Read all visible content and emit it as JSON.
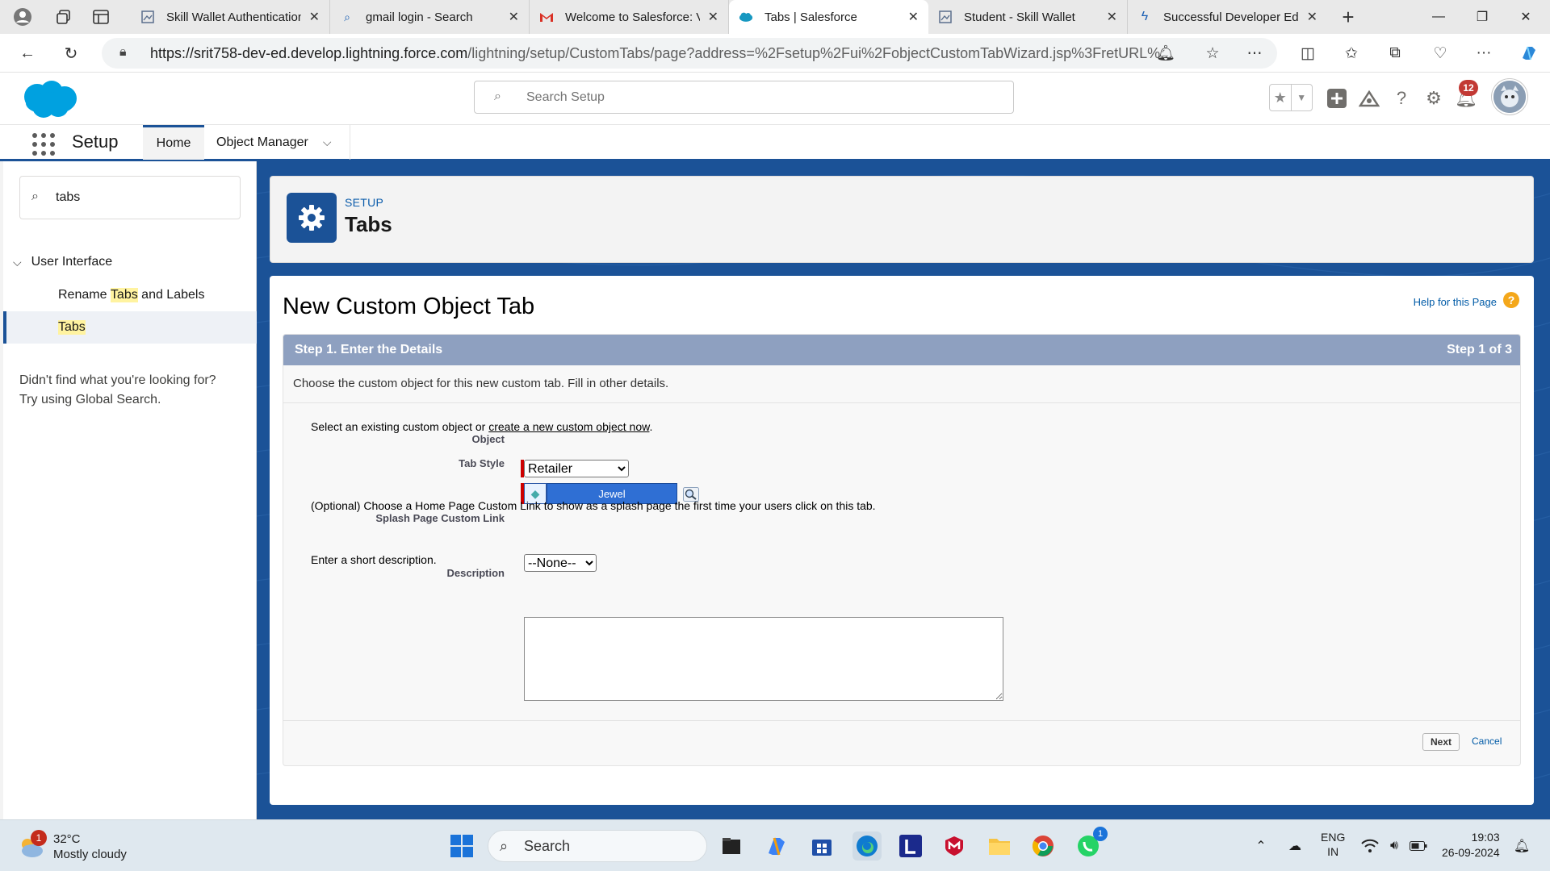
{
  "browser": {
    "tabs": [
      {
        "title": "Skill Wallet Authentication",
        "icon": "page-icon",
        "active": false
      },
      {
        "title": "gmail login - Search",
        "icon": "search-icon",
        "active": false
      },
      {
        "title": "Welcome to Salesforce: Ve",
        "icon": "gmail-icon",
        "active": false
      },
      {
        "title": "Tabs | Salesforce",
        "icon": "salesforce-cloud-icon",
        "active": true
      },
      {
        "title": "Student - Skill Wallet",
        "icon": "page-icon",
        "active": false
      },
      {
        "title": "Successful Developer Editi",
        "icon": "bolt-icon",
        "active": false
      }
    ],
    "url_host": "https://srit758-dev-ed.develop.lightning.force.com",
    "url_path": "/lightning/setup/CustomTabs/page?address=%2Fsetup%2Fui%2FobjectCustomTabWizard.jsp%3FretURL%..."
  },
  "sf_header": {
    "search_placeholder": "Search Setup",
    "notification_count": "12"
  },
  "app_nav": {
    "app_name": "Setup",
    "tabs": [
      "Home",
      "Object Manager"
    ]
  },
  "sidebar": {
    "quick_find_value": "tabs",
    "group_label": "User Interface",
    "items": [
      {
        "pre": "Rename ",
        "highlight": "Tabs",
        "post": " and Labels"
      },
      {
        "pre": "",
        "highlight": "Tabs",
        "post": ""
      }
    ],
    "help_line1": "Didn't find what you're looking for?",
    "help_line2": "Try using Global Search."
  },
  "page_header": {
    "crumb": "SETUP",
    "title": "Tabs"
  },
  "wizard": {
    "title": "New Custom Object Tab",
    "help_link": "Help for this Page",
    "step_label": "Step 1. Enter the Details",
    "step_count": "Step 1 of 3",
    "step_description": "Choose the custom object for this new custom tab. Fill in other details.",
    "select_instruction_pre": "Select an existing custom object or ",
    "select_instruction_link": "create a new custom object now",
    "select_instruction_post": ".",
    "object_label": "Object",
    "object_value": "Retailer",
    "tab_style_label": "Tab Style",
    "tab_style_value": "Jewel",
    "splash_instruction": "(Optional) Choose a Home Page Custom Link to show as a splash page the first time your users click on this tab.",
    "splash_label": "Splash Page Custom Link",
    "splash_value": "--None--",
    "description_instruction": "Enter a short description.",
    "description_label": "Description",
    "description_value": "",
    "next_label": "Next",
    "cancel_label": "Cancel"
  },
  "taskbar": {
    "weather_badge": "1",
    "temperature": "32°C",
    "condition": "Mostly cloudy",
    "search_label": "Search",
    "whatsapp_badge": "1",
    "lang_line1": "ENG",
    "lang_line2": "IN",
    "time": "19:03",
    "date": "26-09-2024"
  },
  "colors": {
    "brand_blue": "#1b5297",
    "step_bar": "#8ea0c0",
    "link": "#015ba7",
    "tab_style_jewel": "#2f6fd4",
    "required_marker": "#cc0000"
  }
}
